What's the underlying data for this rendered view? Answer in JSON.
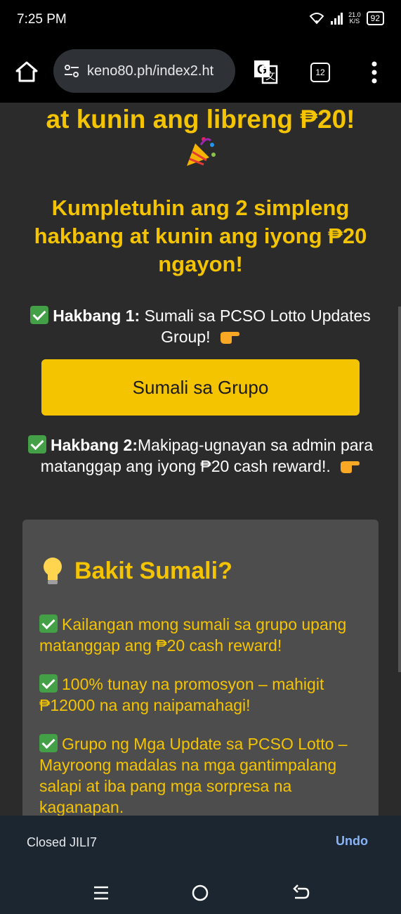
{
  "status_bar": {
    "time": "7:25 PM",
    "net_speed_value": "21.0",
    "net_speed_unit": "K/S",
    "battery": "92"
  },
  "browser": {
    "url": "keno80.ph/index2.ht",
    "tab_count": "12"
  },
  "page": {
    "title": "at kunin ang libreng ₱20!",
    "headline": "Kumpletuhin ang 2 simpleng hakbang at kunin ang iyong ₱20 ngayon!",
    "step1": {
      "label": "Hakbang 1:",
      "text": " Sumali sa PCSO Lotto Updates Group!"
    },
    "join_button": "Sumali sa Grupo",
    "step2": {
      "label": "Hakbang 2:",
      "text": "Makipag-ugnayan sa admin para matanggap ang iyong ₱20 cash reward!."
    },
    "card": {
      "title": "Bakit Sumali?",
      "reasons": [
        "Kailangan mong sumali sa grupo upang matanggap ang ₱20 cash reward!",
        "100% tunay na promosyon – mahigit ₱12000 na ang naipamahagi!",
        "Grupo ng Mga Update sa PCSO Lotto – Mayroong madalas na mga gantimpalang salapi at iba pang mga sorpresa na kaganapan."
      ]
    }
  },
  "snackbar": {
    "message": "Closed JILI7",
    "action": "Undo"
  },
  "colors": {
    "accent": "#f5c400",
    "background": "#2b2b2b",
    "card": "#4d4d4d",
    "link": "#8ab4f8"
  }
}
